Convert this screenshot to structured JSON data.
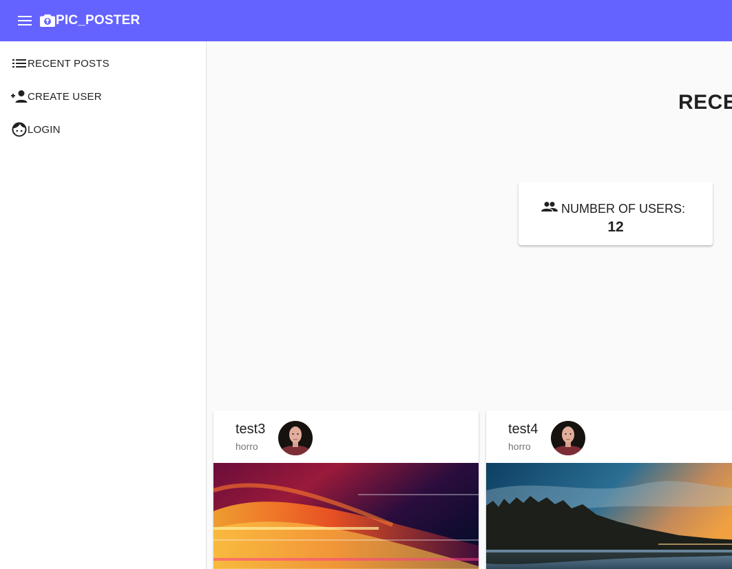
{
  "app": {
    "title": "PIC_POSTER",
    "accent_color": "#6563ff",
    "menu_icon": "menu-icon",
    "logo_icon": "camera-icon"
  },
  "sidebar": {
    "items": [
      {
        "label": "RECENT POSTS",
        "icon": "list-icon"
      },
      {
        "label": "CREATE USER",
        "icon": "person-add-icon"
      },
      {
        "label": "LOGIN",
        "icon": "face-icon"
      }
    ]
  },
  "main": {
    "heading": "RECE",
    "stats": {
      "label": "NUMBER OF USERS:",
      "value": "12",
      "icon": "people-icon"
    },
    "posts": [
      {
        "user": "test3",
        "category": "horro",
        "image": "abstract light streaks"
      },
      {
        "user": "test4",
        "category": "horro",
        "image": "lake sunset landscape"
      }
    ]
  }
}
